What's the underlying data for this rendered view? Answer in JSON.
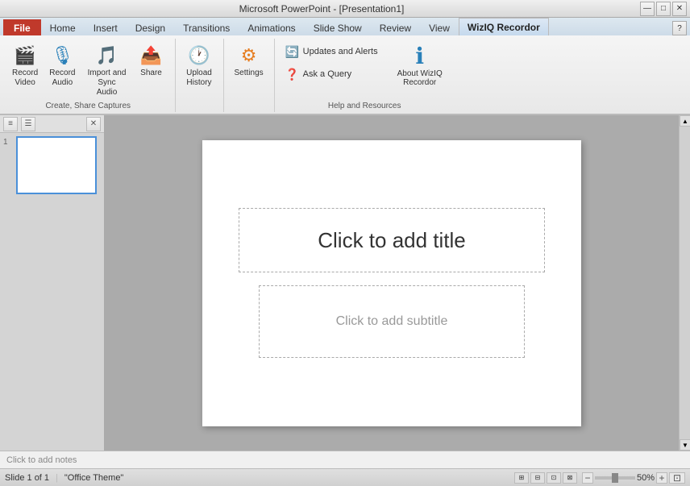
{
  "titlebar": {
    "text": "Microsoft PowerPoint - [Presentation1]",
    "min": "—",
    "max": "□",
    "close": "✕"
  },
  "ribbon": {
    "tabs": [
      {
        "id": "file",
        "label": "File",
        "type": "file"
      },
      {
        "id": "home",
        "label": "Home"
      },
      {
        "id": "insert",
        "label": "Insert"
      },
      {
        "id": "design",
        "label": "Design"
      },
      {
        "id": "transitions",
        "label": "Transitions"
      },
      {
        "id": "animations",
        "label": "Animations"
      },
      {
        "id": "slideshow",
        "label": "Slide Show"
      },
      {
        "id": "review",
        "label": "Review"
      },
      {
        "id": "view",
        "label": "View"
      },
      {
        "id": "wiziq",
        "label": "WizIQ Recordor",
        "type": "wiziq"
      }
    ],
    "groups": {
      "create_share": {
        "label": "Create, Share Captures",
        "items": [
          {
            "id": "record-video",
            "label": "Record\nVideo",
            "icon": "🎬"
          },
          {
            "id": "record-audio",
            "label": "Record\nAudio",
            "icon": "🎙"
          },
          {
            "id": "import-sync",
            "label": "Import and\nSync Audio",
            "icon": "🎵"
          },
          {
            "id": "share",
            "label": "Share",
            "icon": "📤"
          }
        ]
      },
      "upload": {
        "label": "",
        "items": [
          {
            "id": "upload-history",
            "label": "Upload\nHistory",
            "icon": "🕐"
          }
        ]
      },
      "settings": {
        "label": "",
        "items": [
          {
            "id": "settings",
            "label": "Settings",
            "icon": "⚙"
          }
        ]
      },
      "help": {
        "label": "Help and Resources",
        "updates": "Updates and Alerts",
        "query": "Ask a Query",
        "about_label": "About WizIQ\nRecordor",
        "about_icon": "ℹ"
      }
    }
  },
  "panel": {
    "toolbar": {
      "btn1": "≡",
      "btn2": "☰",
      "close": "✕"
    },
    "slide_num": "1"
  },
  "slide": {
    "title_placeholder": "Click to add title",
    "subtitle_placeholder": "Click to add subtitle"
  },
  "notes": {
    "placeholder": "Click to add notes"
  },
  "statusbar": {
    "slide_info": "Slide 1 of 1",
    "theme": "\"Office Theme\"",
    "zoom": "50%",
    "view_icons": [
      "⊞",
      "⊟",
      "⊡",
      "⊠"
    ]
  }
}
